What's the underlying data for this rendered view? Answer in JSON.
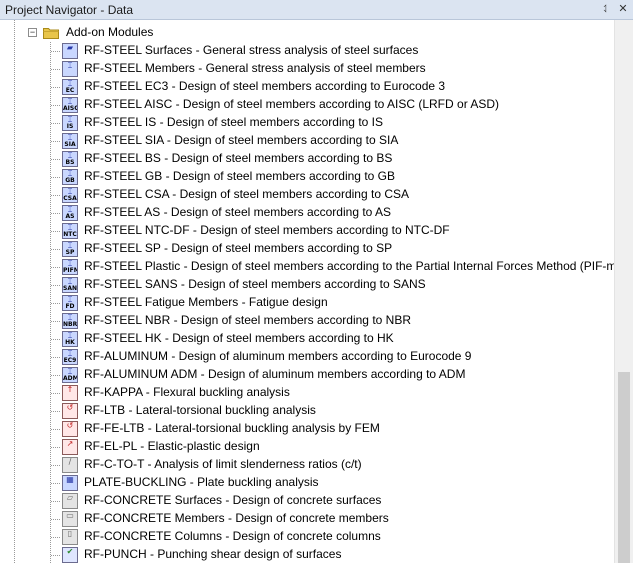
{
  "window": {
    "title": "Project Navigator - Data",
    "pin_glyph": "⥑",
    "close_glyph": "✕"
  },
  "tree": {
    "parent": {
      "expander": "−",
      "icon": "folder-icon",
      "label": "Add-on Modules"
    },
    "items": [
      {
        "label": "RF-STEEL Surfaces - General stress analysis of steel surfaces",
        "code": "",
        "glyph": "▰",
        "tint": "blue"
      },
      {
        "label": "RF-STEEL Members - General stress analysis of steel members",
        "code": "",
        "glyph": "⌶",
        "tint": "blue"
      },
      {
        "label": "RF-STEEL EC3 - Design of steel members according to Eurocode 3",
        "code": "EC",
        "glyph": "⌶",
        "tint": "blue"
      },
      {
        "label": "RF-STEEL AISC - Design of steel members according to AISC (LRFD or ASD)",
        "code": "AISC",
        "glyph": "⌶",
        "tint": "blue"
      },
      {
        "label": "RF-STEEL IS - Design of steel members according to IS",
        "code": "IS",
        "glyph": "⌶",
        "tint": "blue"
      },
      {
        "label": "RF-STEEL SIA - Design of steel members according to SIA",
        "code": "SIA",
        "glyph": "⌶",
        "tint": "blue"
      },
      {
        "label": "RF-STEEL BS - Design of steel members according to BS",
        "code": "BS",
        "glyph": "⌶",
        "tint": "blue"
      },
      {
        "label": "RF-STEEL GB - Design of steel members according to GB",
        "code": "GB",
        "glyph": "⌶",
        "tint": "blue"
      },
      {
        "label": "RF-STEEL CSA - Design of steel members according to CSA",
        "code": "CSA",
        "glyph": "⌶",
        "tint": "blue"
      },
      {
        "label": "RF-STEEL AS - Design of steel members according to AS",
        "code": "AS",
        "glyph": "⌶",
        "tint": "blue"
      },
      {
        "label": "RF-STEEL NTC-DF - Design of steel members according to NTC-DF",
        "code": "NTC",
        "glyph": "⌶",
        "tint": "blue"
      },
      {
        "label": "RF-STEEL SP - Design of steel members according to SP",
        "code": "SP",
        "glyph": "⌶",
        "tint": "blue"
      },
      {
        "label": "RF-STEEL Plastic - Design of steel members according to the Partial Internal Forces Method (PIF-meth",
        "code": "PIFM",
        "glyph": "⌶",
        "tint": "blue"
      },
      {
        "label": "RF-STEEL SANS - Design of steel members according to SANS",
        "code": "SANS",
        "glyph": "⌶",
        "tint": "blue"
      },
      {
        "label": "RF-STEEL Fatigue Members - Fatigue design",
        "code": "FD",
        "glyph": "⌶",
        "tint": "blue"
      },
      {
        "label": "RF-STEEL NBR - Design of steel members according to NBR",
        "code": "NBR",
        "glyph": "⌶",
        "tint": "blue"
      },
      {
        "label": "RF-STEEL HK - Design of steel members according to HK",
        "code": "HK",
        "glyph": "⌶",
        "tint": "blue"
      },
      {
        "label": "RF-ALUMINUM - Design of aluminum members according to Eurocode 9",
        "code": "EC9",
        "glyph": "⌶",
        "tint": "blue"
      },
      {
        "label": "RF-ALUMINUM ADM - Design of aluminum members according to ADM",
        "code": "ADM",
        "glyph": "⌶",
        "tint": "blue"
      },
      {
        "label": "RF-KAPPA - Flexural buckling analysis",
        "code": "",
        "glyph": "↑",
        "tint": "red"
      },
      {
        "label": "RF-LTB - Lateral-torsional buckling analysis",
        "code": "",
        "glyph": "↺",
        "tint": "red"
      },
      {
        "label": "RF-FE-LTB - Lateral-torsional buckling analysis by FEM",
        "code": "",
        "glyph": "↺",
        "tint": "red"
      },
      {
        "label": "RF-EL-PL - Elastic-plastic design",
        "code": "",
        "glyph": "↗",
        "tint": "red"
      },
      {
        "label": "RF-C-TO-T - Analysis of limit slenderness ratios (c/t)",
        "code": "",
        "glyph": "∕",
        "tint": "gray"
      },
      {
        "label": "PLATE-BUCKLING - Plate buckling analysis",
        "code": "",
        "glyph": "▦",
        "tint": "blue"
      },
      {
        "label": "RF-CONCRETE Surfaces - Design of concrete surfaces",
        "code": "",
        "glyph": "▱",
        "tint": "gray"
      },
      {
        "label": "RF-CONCRETE Members - Design of concrete members",
        "code": "",
        "glyph": "▭",
        "tint": "gray"
      },
      {
        "label": "RF-CONCRETE Columns - Design of concrete columns",
        "code": "",
        "glyph": "▯",
        "tint": "gray"
      },
      {
        "label": "RF-PUNCH - Punching shear design of surfaces",
        "code": "",
        "glyph": "✔",
        "tint": "green"
      }
    ]
  },
  "scrollbar": {
    "position_fraction": 0.65
  }
}
